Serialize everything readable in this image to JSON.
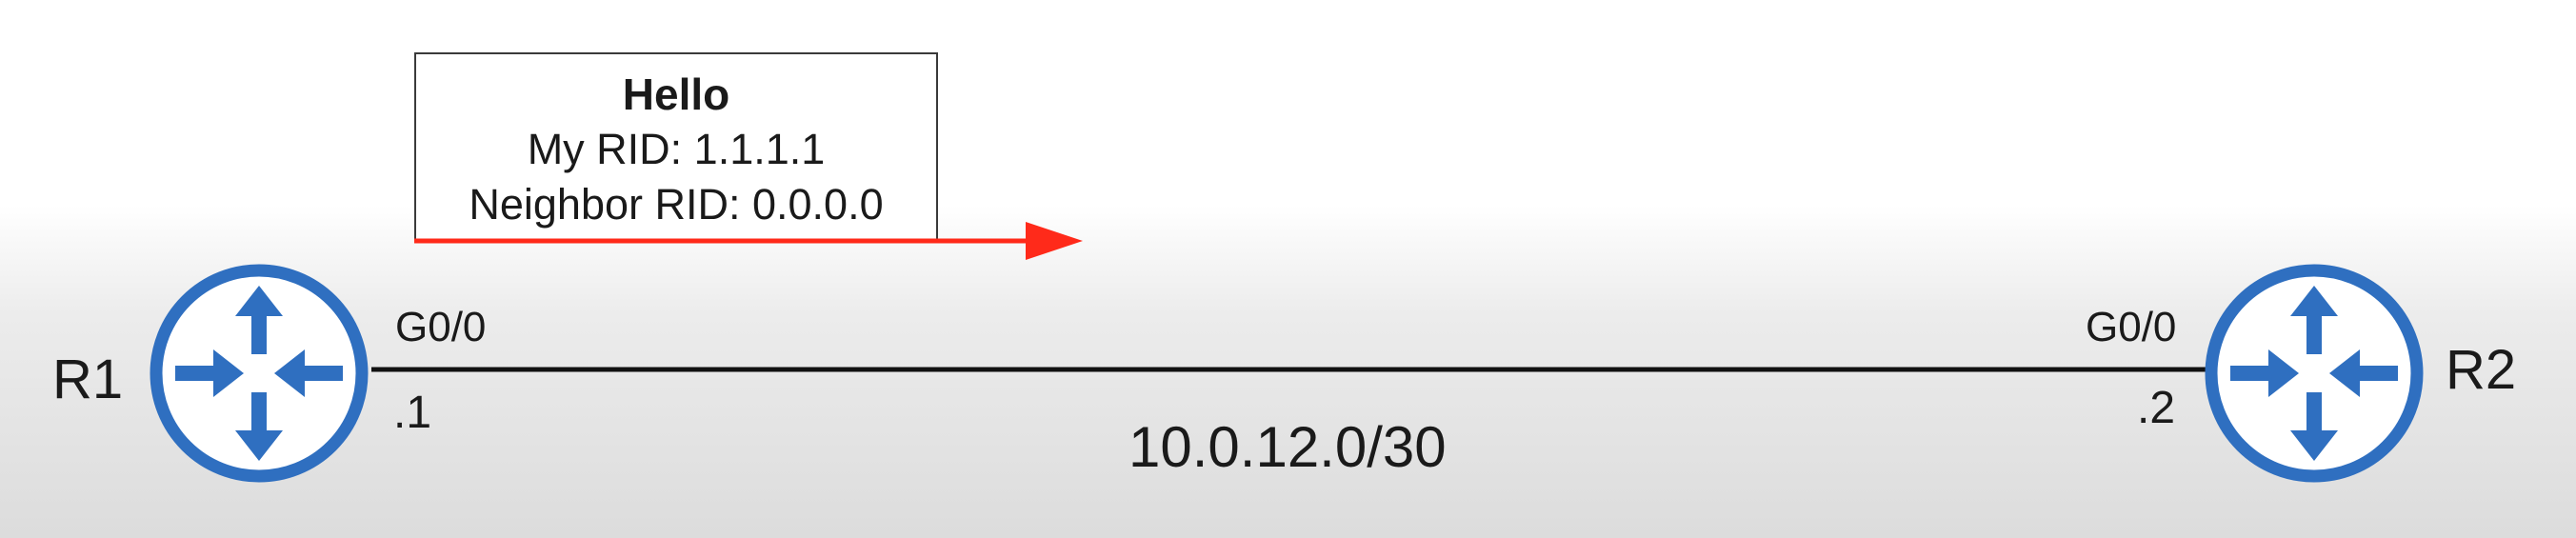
{
  "hello_message": {
    "title": "Hello",
    "my_rid": "My RID: 1.1.1.1",
    "neighbor_rid": "Neighbor RID: 0.0.0.0",
    "arrow_color": "#ff2a1a"
  },
  "routers": {
    "r1": {
      "name": "R1",
      "interface": "G0/0",
      "address": ".1"
    },
    "r2": {
      "name": "R2",
      "interface": "G0/0",
      "address": ".2"
    }
  },
  "link": {
    "subnet": "10.0.12.0/30"
  },
  "colors": {
    "router_blue": "#2f6fc0",
    "link": "#111111"
  }
}
